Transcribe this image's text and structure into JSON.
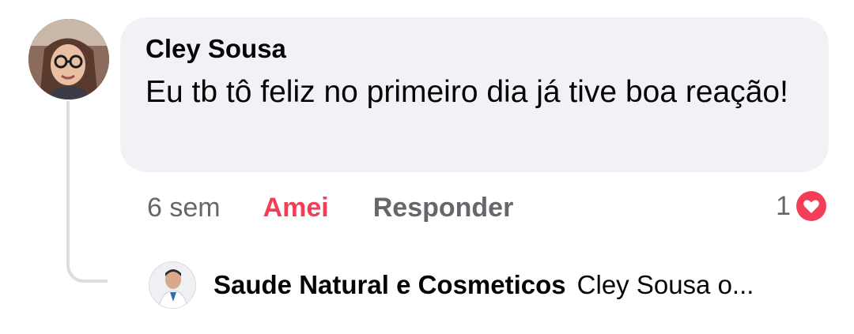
{
  "comment": {
    "author": "Cley Sousa",
    "text": "Eu tb tô feliz no primeiro dia já tive boa reação!",
    "avatar_icon": "profile-photo",
    "actions": {
      "time": "6 sem",
      "love": "Amei",
      "reply": "Responder"
    },
    "reactions": {
      "count": "1",
      "icon": "love-reaction-icon",
      "color": "#f33e58"
    }
  },
  "reply": {
    "author": "Saude Natural e Cosmeticos",
    "snippet": "Cley Sousa o...",
    "avatar_icon": "page-profile-photo"
  },
  "colors": {
    "bubble": "#f0f2f5",
    "secondary_text": "#65676b",
    "love": "#f33e58",
    "thread_line": "#dadde1"
  }
}
